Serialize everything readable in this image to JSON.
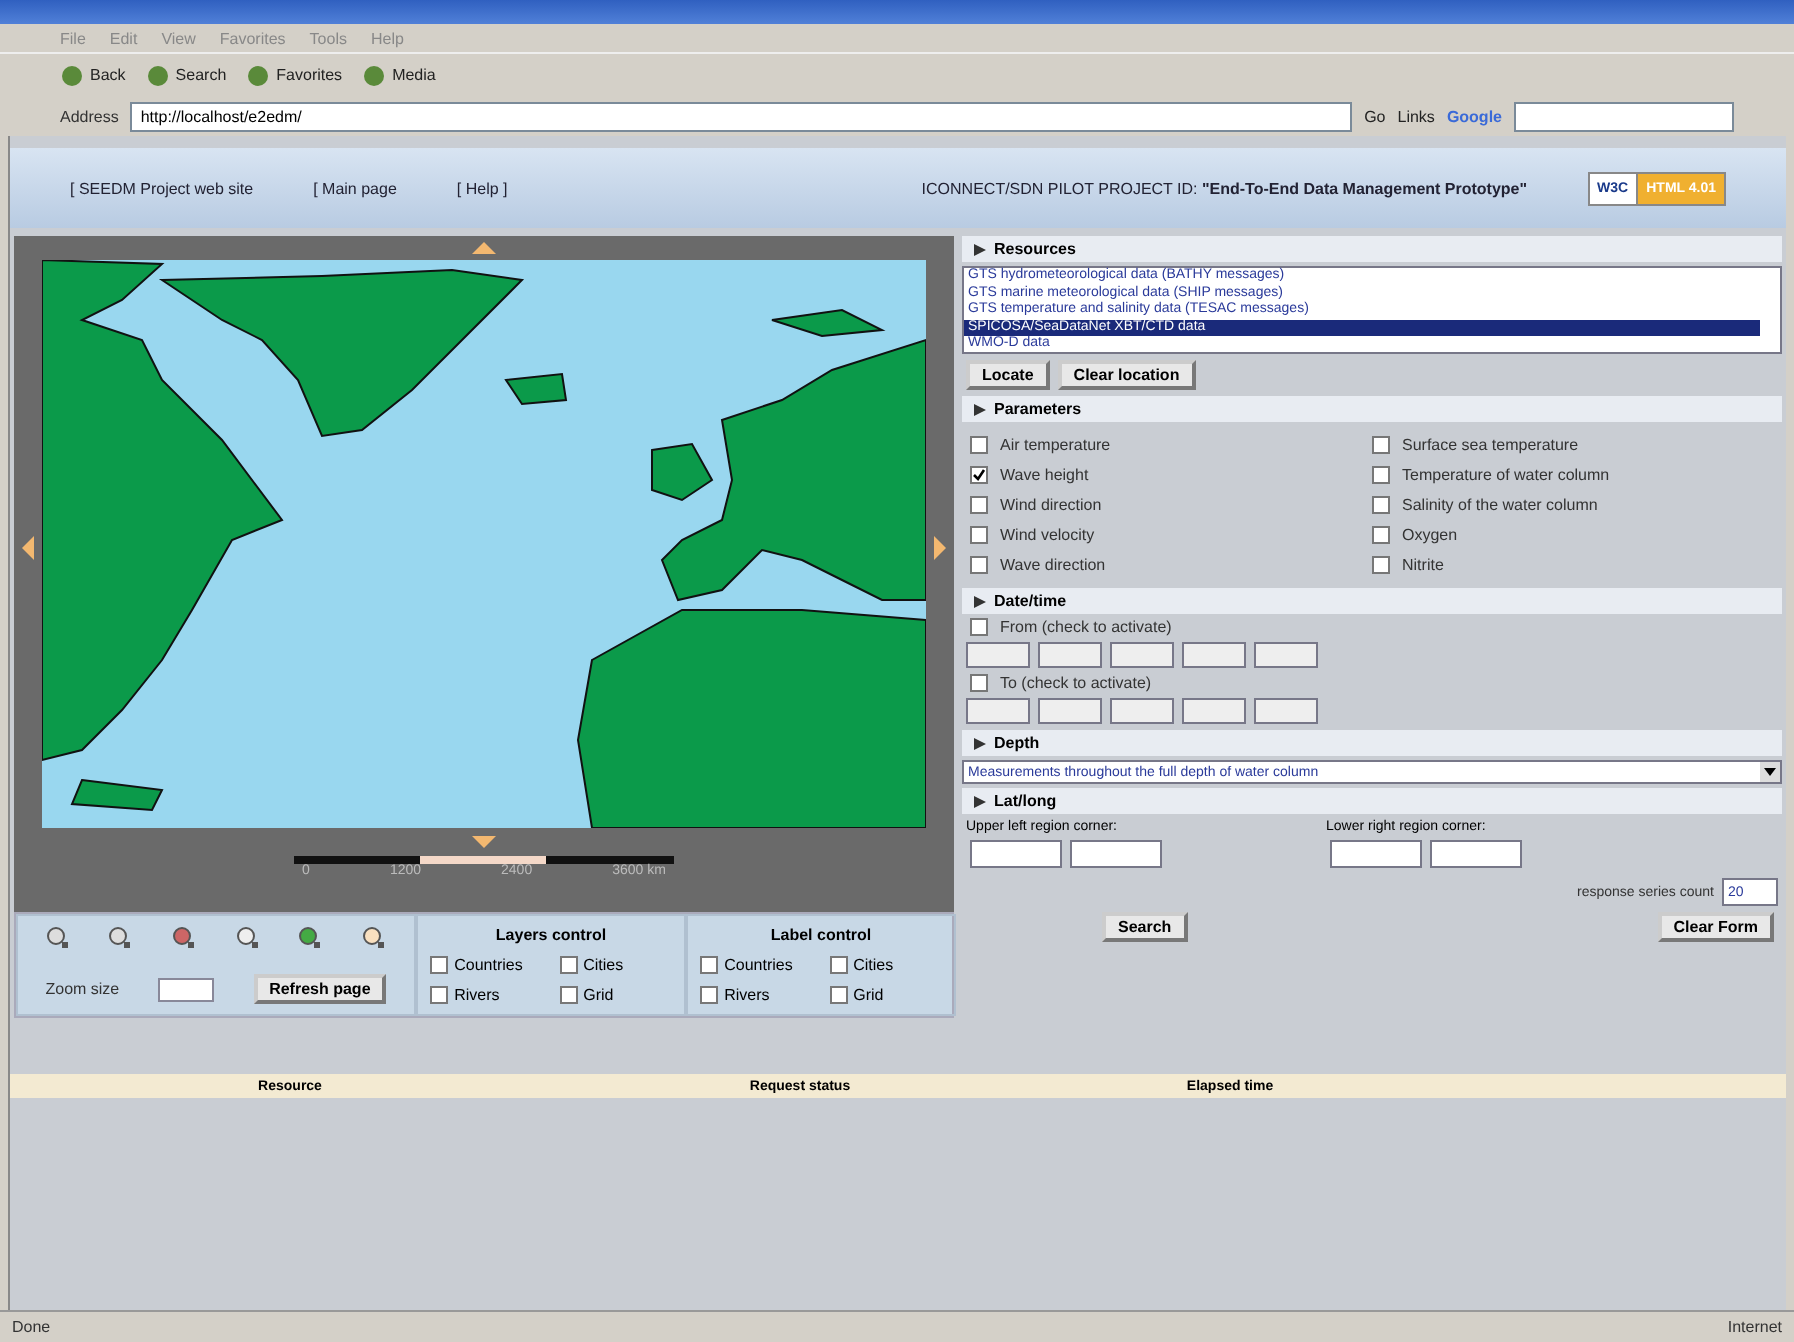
{
  "browser": {
    "menu": [
      "File",
      "Edit",
      "View",
      "Favorites",
      "Tools",
      "Help"
    ],
    "toolbar": [
      "Back",
      "Search",
      "Favorites",
      "Media"
    ],
    "address_label": "Address",
    "url": "http://localhost/e2edm/",
    "go": "Go",
    "links": "Links",
    "google": "Google"
  },
  "header": {
    "links": [
      "[ SEEDM Project web site",
      "[ Main page",
      "[ Help ]"
    ],
    "project_label": "ICONNECT/SDN PILOT PROJECT ID:",
    "project_title": "\"End-To-End Data Management Prototype\"",
    "badge": [
      "W3C",
      "HTML 4.01"
    ]
  },
  "map": {
    "scale_labels": [
      "0",
      "1200",
      "2400",
      "3600 km"
    ]
  },
  "map_tools": {
    "zoom_label": "Zoom size",
    "refresh": "Refresh page",
    "groups": [
      {
        "title": "Layers control",
        "options": [
          {
            "label": "Countries",
            "checked": false
          },
          {
            "label": "Cities",
            "checked": false
          },
          {
            "label": "Rivers",
            "checked": false
          },
          {
            "label": "Grid",
            "checked": false
          }
        ]
      },
      {
        "title": "Label control",
        "options": [
          {
            "label": "Countries",
            "checked": false
          },
          {
            "label": "Cities",
            "checked": false
          },
          {
            "label": "Rivers",
            "checked": false
          },
          {
            "label": "Grid",
            "checked": false
          }
        ]
      }
    ]
  },
  "resources": {
    "title": "Resources",
    "items": [
      {
        "label": "GTS hydrometeorological data (BATHY messages)",
        "selected": false
      },
      {
        "label": "GTS marine meteorological data (SHIP messages)",
        "selected": false
      },
      {
        "label": "GTS temperature and salinity data (TESAC messages)",
        "selected": false
      },
      {
        "label": "SPICOSA/SeaDataNet XBT/CTD data",
        "selected": true
      },
      {
        "label": "WMO-D data",
        "selected": false
      }
    ],
    "buttons": [
      "Locate",
      "Clear location"
    ]
  },
  "parameters": {
    "title": "Parameters",
    "items": [
      {
        "label": "Air temperature",
        "checked": false
      },
      {
        "label": "Wave height",
        "checked": true
      },
      {
        "label": "Wind direction",
        "checked": false
      },
      {
        "label": "Wind velocity",
        "checked": false
      },
      {
        "label": "Wave direction",
        "checked": false
      },
      {
        "label": "Surface sea temperature",
        "checked": false
      },
      {
        "label": "Temperature of water column",
        "checked": false
      },
      {
        "label": "Salinity of the water column",
        "checked": false
      },
      {
        "label": "Oxygen",
        "checked": false
      },
      {
        "label": "Nitrite",
        "checked": false
      }
    ]
  },
  "datetime": {
    "title": "Date/time",
    "ranges": [
      {
        "label": "From (check to activate)",
        "checked": false
      },
      {
        "label": "To (check to activate)",
        "checked": false
      }
    ]
  },
  "depth": {
    "title": "Depth",
    "value": "Measurements throughout the full depth of water column"
  },
  "latlong": {
    "title": "Lat/long",
    "corners": [
      "Upper left region corner:",
      "Lower right region corner:"
    ]
  },
  "count": {
    "label": "response series count",
    "value": "20"
  },
  "actions": [
    "Search",
    "Clear Form"
  ],
  "results": {
    "columns": [
      "Resource",
      "Request status",
      "Elapsed time"
    ]
  },
  "status": {
    "text": "Done",
    "zone": "Internet"
  }
}
